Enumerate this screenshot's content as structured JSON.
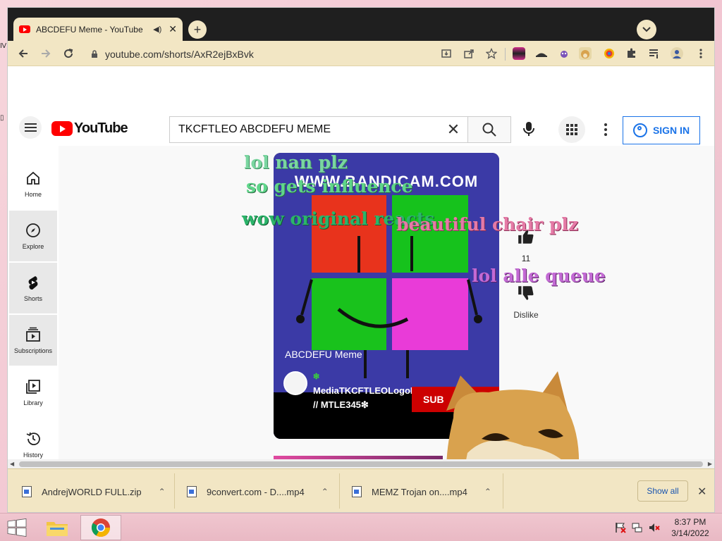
{
  "browser": {
    "tab": {
      "title": "ABCDEFU Meme - YouTube",
      "speaker": "◀)",
      "close": "✕"
    },
    "new_tab": "+",
    "tab_search": "⌄",
    "url": "youtube.com/shorts/AxR2ejBxBvk"
  },
  "youtube": {
    "logo_text": "YouTube",
    "search_query": "TKCFTLEO ABCDEFU MEME",
    "clear_search": "✕",
    "sign_in_label": "SIGN IN",
    "sidebar": [
      {
        "label": "Home",
        "icon": "home-icon"
      },
      {
        "label": "Explore",
        "icon": "compass-icon"
      },
      {
        "label": "Shorts",
        "icon": "shorts-icon"
      },
      {
        "label": "Subscriptions",
        "icon": "subscriptions-icon"
      },
      {
        "label": "Library",
        "icon": "library-icon"
      },
      {
        "label": "History",
        "icon": "history-icon"
      }
    ],
    "short": {
      "watermark": "WWW.BANDICAM.COM",
      "title": "ABCDEFU Meme",
      "channel_prefix": "❇",
      "channel_name": "MediaTKCFTLEOLogoEditor345 // MTLE345❇",
      "subscribe_label": "SUB"
    },
    "likes": {
      "count": "11"
    },
    "dislike": {
      "label": "Dislike"
    }
  },
  "overlay_comments": [
    "lol nan plz",
    "so gets influence",
    "wow original reacts",
    "beautiful chair plz",
    "lol alle queue"
  ],
  "downloads": {
    "items": [
      {
        "name": "AndrejWORLD FULL.zip"
      },
      {
        "name": "9convert.com - D....mp4"
      },
      {
        "name": "MEMZ Trojan on....mp4"
      }
    ],
    "show_all": "Show all",
    "close": "✕"
  },
  "taskbar": {
    "clock_time": "8:37 PM",
    "clock_date": "3/14/2022"
  },
  "colors": {
    "chrome_theme": "#f2e6c4",
    "youtube_red": "#ff0000",
    "sign_in_blue": "#1a73e8",
    "short_bg": "#3b3aa6"
  }
}
